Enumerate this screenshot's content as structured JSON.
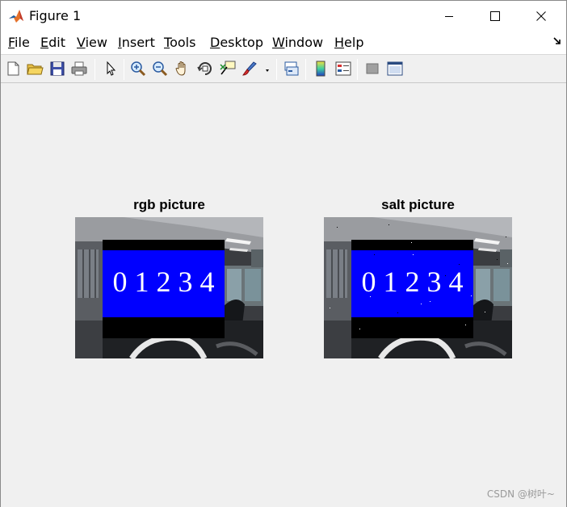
{
  "window": {
    "title": "Figure 1"
  },
  "menu": {
    "items": [
      {
        "label": "File"
      },
      {
        "label": "Edit"
      },
      {
        "label": "View"
      },
      {
        "label": "Insert"
      },
      {
        "label": "Tools"
      },
      {
        "label": "Desktop"
      },
      {
        "label": "Window"
      },
      {
        "label": "Help"
      }
    ]
  },
  "toolbar": {
    "buttons": [
      "new-figure-icon",
      "open-file-icon",
      "save-icon",
      "print-icon",
      "edit-plot-arrow-icon",
      "zoom-in-icon",
      "zoom-out-icon",
      "pan-hand-icon",
      "rotate-3d-icon",
      "data-cursor-icon",
      "brush-icon",
      "link-plot-icon",
      "colorbar-icon",
      "legend-icon",
      "hide-plot-tools-icon",
      "show-plot-tools-icon"
    ]
  },
  "axes": [
    {
      "title": "rgb picture",
      "overlay_text": "0 1 2 3 4",
      "noise": false
    },
    {
      "title": "salt picture",
      "overlay_text": "0 1 2 3 4",
      "noise": true
    }
  ],
  "watermark": "CSDN @树叶~",
  "colors": {
    "label_blue": "#0000ff",
    "label_black": "#000000",
    "figure_bg": "#f0f0f0"
  }
}
